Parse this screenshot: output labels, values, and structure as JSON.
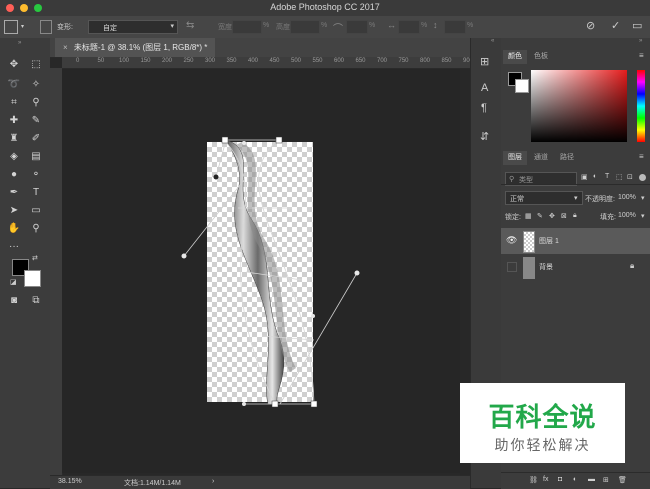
{
  "window": {
    "title": "Adobe Photoshop CC 2017",
    "traffic_lights": [
      "#ff5f57",
      "#febc2e",
      "#28c840"
    ]
  },
  "options_bar": {
    "transform_label": "变形:",
    "transform_value": "自定",
    "width_label": "宽度:",
    "height_label": "高度:",
    "percent_sign": "%"
  },
  "document": {
    "tab_title": "未标题-1 @ 38.1% (图层 1, RGB/8*) *",
    "ruler_ticks": [
      "0",
      "50",
      "100",
      "150",
      "200",
      "250",
      "300",
      "350",
      "400",
      "450",
      "500",
      "550",
      "600",
      "650",
      "700",
      "750",
      "800",
      "850",
      "900"
    ],
    "zoom": "38.15%",
    "doc_info": "文档:1.14M/1.14M"
  },
  "panels": {
    "color_tab": "颜色",
    "swatches_tab": "色板",
    "layers_tab": "图层",
    "channels_tab": "通道",
    "paths_tab": "路径",
    "filter_placeholder": "类型",
    "blend_mode": "正常",
    "opacity_label": "不透明度:",
    "opacity_value": "100%",
    "lock_label": "锁定:",
    "fill_label": "填充:",
    "fill_value": "100%",
    "layers": [
      {
        "name": "图层 1"
      },
      {
        "name": "背景"
      }
    ]
  },
  "watermark": {
    "title": "百科全说",
    "subtitle": "助你轻松解决"
  },
  "colors": {
    "accent_watermark": "#22a84a"
  }
}
